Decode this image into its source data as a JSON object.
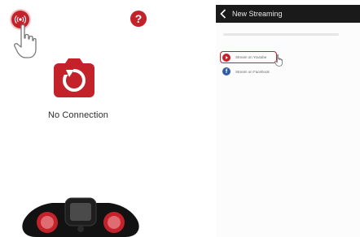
{
  "left": {
    "status_text": "No Connection",
    "help_symbol": "?",
    "icons": {
      "stream": "live-stream-icon",
      "cursor": "hand-pointer-icon",
      "camera": "camera-refresh-icon",
      "controller": "handheld-controller"
    }
  },
  "right": {
    "title": "New Streaming",
    "options": [
      {
        "label": "Stream on Youtube",
        "icon": "youtube-icon",
        "selected": true
      },
      {
        "label": "Stream on Facebook",
        "icon": "facebook-icon",
        "selected": false
      }
    ],
    "facebook_glyph": "f"
  },
  "colors": {
    "accent_red": "#c3222b",
    "title_bar": "#1a1a1a",
    "facebook_blue": "#2f5ba8"
  }
}
